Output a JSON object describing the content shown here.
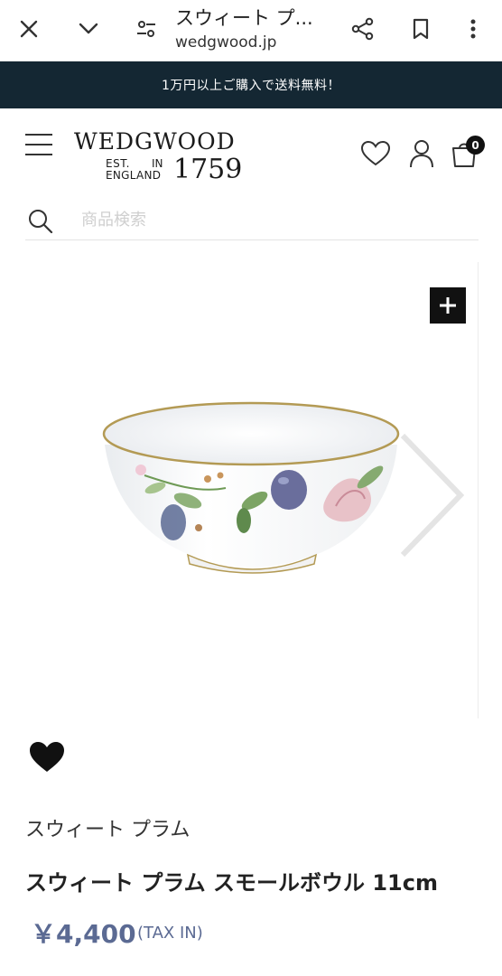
{
  "browser": {
    "page_title": "スウィート プ...",
    "url": "wedgwood.jp",
    "icons": [
      "close-icon",
      "chevron-down-icon",
      "site-settings-icon",
      "share-icon",
      "bookmark-icon",
      "more-vert-icon"
    ]
  },
  "promo": {
    "text": "1万円以上ご購入で送料無料！",
    "background": "#142733"
  },
  "header": {
    "logo": {
      "wordmark": "WEDGWOOD",
      "est": "EST.",
      "in": "IN",
      "england": "ENGLAND",
      "year": "1759"
    },
    "cart_count": "0",
    "icons": [
      "menu-icon",
      "wishlist-icon",
      "account-icon",
      "cart-icon"
    ]
  },
  "search": {
    "placeholder": "商品検索",
    "value": ""
  },
  "gallery": {
    "image_alt": "スウィート プラム スモールボウル",
    "icons": [
      "zoom-plus-icon",
      "next-arrow-icon"
    ]
  },
  "product": {
    "collection": "スウィート プラム",
    "name": "スウィート プラム スモールボウル 11cm",
    "price": "￥4,400",
    "tax_note": "(TAX IN)",
    "price_color": "#5b6a93"
  }
}
